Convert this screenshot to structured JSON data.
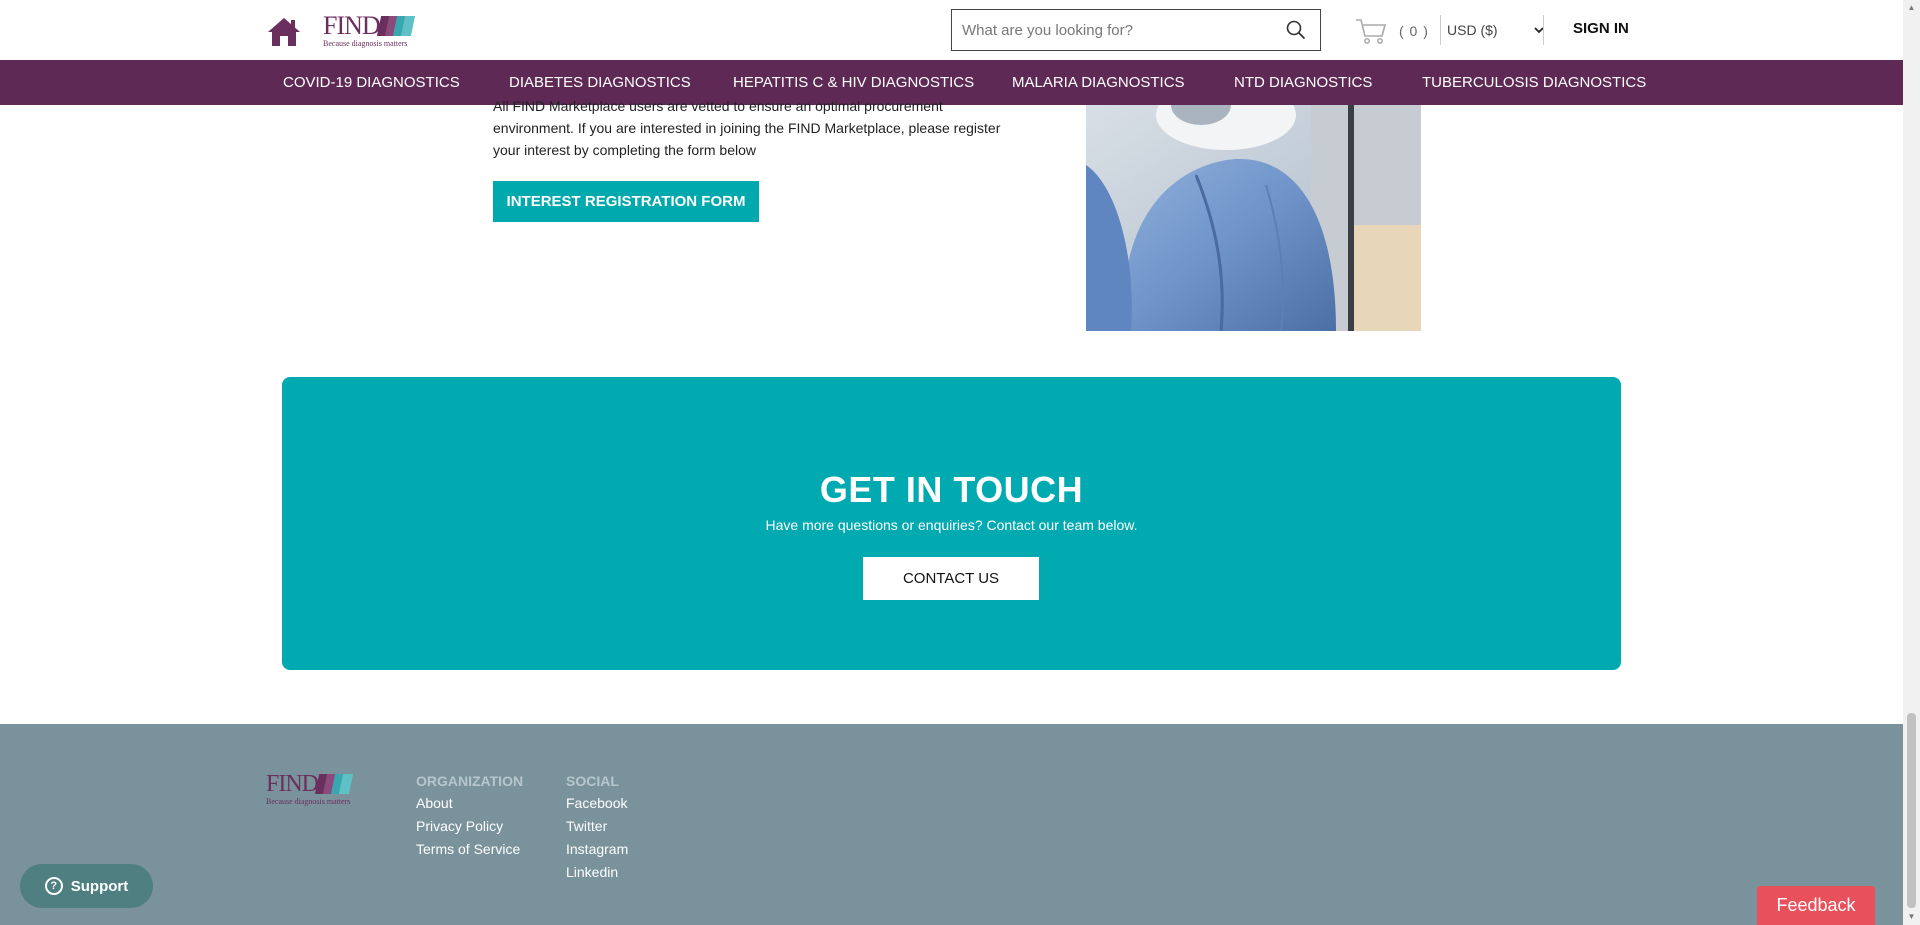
{
  "header": {
    "logo_text": "FIND",
    "logo_tagline": "Because diagnosis matters",
    "search_placeholder": "What are you looking for?",
    "cart_count": "( 0 )",
    "currency": "USD ($)",
    "sign_in": "SIGN IN"
  },
  "nav": {
    "items": [
      {
        "label": "COVID-19 DIAGNOSTICS"
      },
      {
        "label": "DIABETES DIAGNOSTICS"
      },
      {
        "label": "HEPATITIS C & HIV DIAGNOSTICS"
      },
      {
        "label": "MALARIA DIAGNOSTICS"
      },
      {
        "label": "NTD DIAGNOSTICS"
      },
      {
        "label": "TUBERCULOSIS DIAGNOSTICS"
      }
    ]
  },
  "intro": {
    "text": "All FIND Marketplace users are vetted to ensure an optimal procurement environment. If you are interested in joining the FIND Marketplace, please register your interest by completing the form below",
    "button": "INTEREST REGISTRATION FORM"
  },
  "touch": {
    "title": "GET IN TOUCH",
    "subtitle": "Have more questions or enquiries? Contact our team below.",
    "button": "CONTACT US"
  },
  "footer": {
    "logo_text": "FIND",
    "logo_tagline": "Because diagnosis matters",
    "organization": {
      "heading": "ORGANIZATION",
      "links": [
        "About",
        "Privacy Policy",
        "Terms of Service"
      ]
    },
    "social": {
      "heading": "SOCIAL",
      "links": [
        "Facebook",
        "Twitter",
        "Instagram",
        "Linkedin"
      ]
    }
  },
  "widgets": {
    "support": "Support",
    "feedback": "Feedback"
  },
  "colors": {
    "brand_purple": "#5e2a55",
    "accent_teal": "#00aab0",
    "footer_bg": "#7a929c",
    "feedback_red": "#e8505b"
  }
}
